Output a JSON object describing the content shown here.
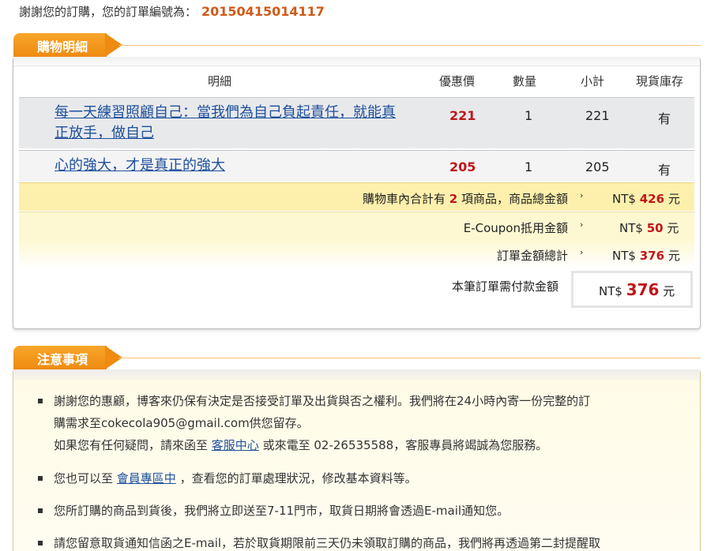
{
  "header": {
    "thanks_text": "謝謝您的訂購，您的訂單編號為：",
    "order_number": "20150415014117"
  },
  "detail_section": {
    "title": "購物明細",
    "columns": {
      "item": "明細",
      "price": "優惠價",
      "qty": "數量",
      "subtotal": "小計",
      "stock": "現貨庫存"
    },
    "items": [
      {
        "title_line1": "每一天練習照顧自己：當我們為自己負起責任，就能真",
        "title_line2": "正放手，做自己",
        "price": "221",
        "qty": "1",
        "subtotal": "221",
        "stock": "有"
      },
      {
        "title_line1": "心的強大，才是真正的強大",
        "title_line2": "",
        "price": "205",
        "qty": "1",
        "subtotal": "205",
        "stock": "有"
      }
    ],
    "summary": {
      "cart_prefix": "購物車內合計有",
      "cart_count": "2",
      "cart_suffix": "項商品，商品總金額",
      "cart_total": "426",
      "coupon_label": "E-Coupon抵用金額",
      "coupon_amount": "50",
      "order_total_label": "訂單金額總計",
      "order_total": "376",
      "currency": "NT$",
      "unit": "元",
      "arrow": "›",
      "pay_label": "本筆訂單需付款金額",
      "pay_amount": "376"
    }
  },
  "notice_section": {
    "title": "注意事項",
    "items": [
      {
        "line1": "謝謝您的惠顧，博客來仍保有決定是否接受訂單及出貨與否之權利。我們將在24小時內寄一份完整的訂",
        "line2": "購需求至cokecola905@gmail.com供您留存。",
        "line3_prefix": "如果您有任何疑問，請來函至",
        "line3_link": "客服中心",
        "line3_suffix": "或來電至 02-26535588，客服專員將竭誠為您服務。"
      },
      {
        "prefix": "您也可以至",
        "link": "會員專區中",
        "suffix": "，查看您的訂單處理狀況，修改基本資料等。"
      },
      {
        "text": "您所訂購的商品到貨後，我們將立即送至7-11門市，取貨日期將會透過E-mail通知您。"
      },
      {
        "text": "請您留意取貨通知信函之E-mail，若於取貨期限前三天仍未領取訂購的商品，我們將再透過第二封提醒取"
      }
    ]
  },
  "colors": {
    "accent_orange": "#ee8b10",
    "price_red": "#c0161b",
    "link_blue": "#1d4f9c",
    "order_number_orange": "#d05a18"
  }
}
